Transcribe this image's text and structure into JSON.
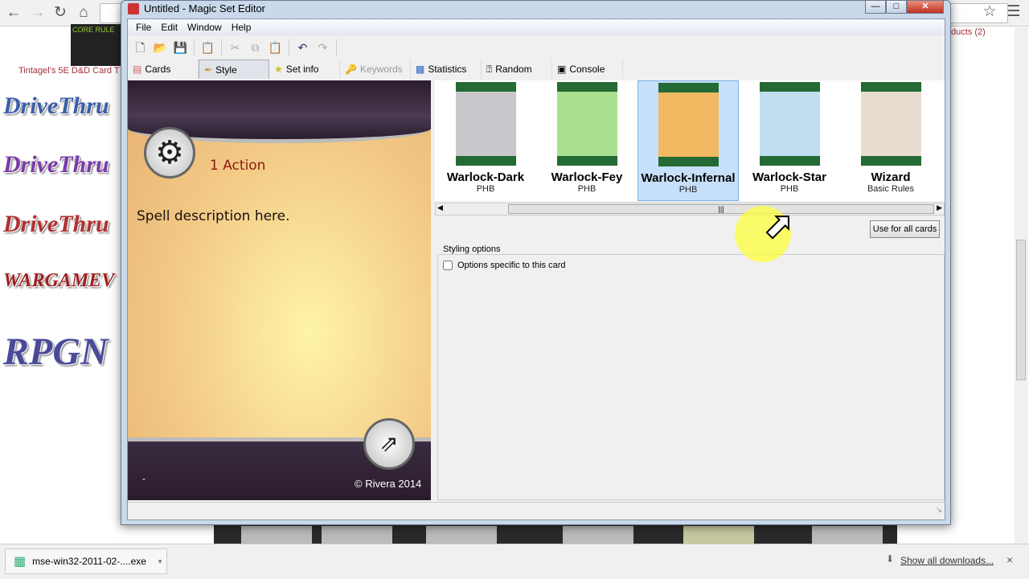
{
  "browser": {
    "page_text": "Tintagel's 5E D&D Card T",
    "products": "ducts (2)",
    "thumbnail_text": "CORE RULE",
    "logos": [
      "DriveThru",
      "DriveThru",
      "DriveThru",
      "WARGAMEV",
      "RPGN"
    ]
  },
  "downloads": {
    "file": "mse-win32-2011-02-....exe",
    "show_all": "Show all downloads...",
    "close": "×"
  },
  "window": {
    "title": "Untitled - Magic Set Editor",
    "menu": [
      "File",
      "Edit",
      "Window",
      "Help"
    ],
    "tabs": [
      {
        "label": "Cards",
        "icon": "cards-icon"
      },
      {
        "label": "Style",
        "icon": "brush-icon",
        "active": true
      },
      {
        "label": "Set info",
        "icon": "star-icon"
      },
      {
        "label": "Keywords",
        "icon": "key-icon",
        "disabled": true
      },
      {
        "label": "Statistics",
        "icon": "chart-icon"
      },
      {
        "label": "Random",
        "icon": "question-icon"
      },
      {
        "label": "Console",
        "icon": "console-icon"
      }
    ],
    "card": {
      "action": "1 Action",
      "description": "Spell description here.",
      "copyright": "© Rivera 2014",
      "footer_left": "-"
    },
    "styles": [
      {
        "name": "Warlock-Dark",
        "sub": "PHB",
        "color": "#c8c8cc"
      },
      {
        "name": "Warlock-Fey",
        "sub": "PHB",
        "color": "#a8e090"
      },
      {
        "name": "Warlock-Infernal",
        "sub": "PHB",
        "color": "#f0b860",
        "selected": true
      },
      {
        "name": "Warlock-Star",
        "sub": "PHB",
        "color": "#c0def0"
      },
      {
        "name": "Wizard",
        "sub": "Basic Rules",
        "color": "#e8dcd0"
      }
    ],
    "use_all": "Use for all cards",
    "styling_options": {
      "label": "Styling options",
      "checkbox": "Options specific to this card",
      "checked": false
    }
  }
}
